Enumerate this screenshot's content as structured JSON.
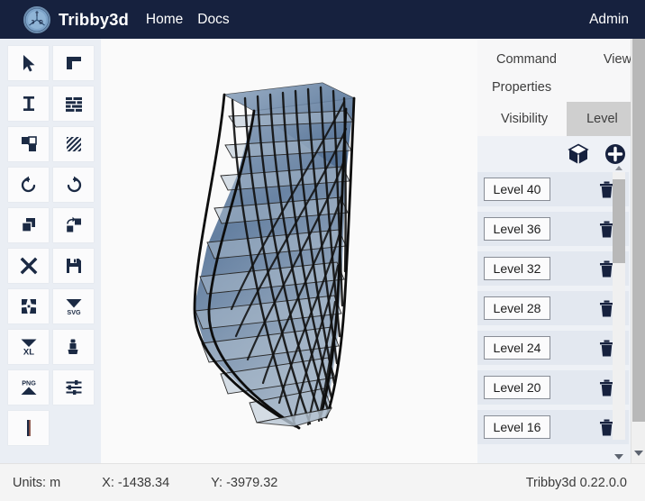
{
  "navbar": {
    "logo_letters": [
      "T",
      "3",
      "D"
    ],
    "brand": "Tribby3d",
    "links": [
      {
        "label": "Home"
      },
      {
        "label": "Docs"
      }
    ],
    "account": "Admin"
  },
  "toolbar": {
    "tools": [
      {
        "name": "select-cursor",
        "label": "Select"
      },
      {
        "name": "slab-corner",
        "label": "Slab"
      },
      {
        "name": "column",
        "label": "Column"
      },
      {
        "name": "wall-brick",
        "label": "Wall"
      },
      {
        "name": "opening",
        "label": "Opening"
      },
      {
        "name": "hatch-area",
        "label": "Area load"
      },
      {
        "name": "undo-arrow",
        "label": "Undo"
      },
      {
        "name": "redo-arrow",
        "label": "Redo"
      },
      {
        "name": "copy-duplicate",
        "label": "Copy"
      },
      {
        "name": "move-to",
        "label": "Move"
      },
      {
        "name": "delete-cross",
        "label": "Delete"
      },
      {
        "name": "save-floppy",
        "label": "Save"
      },
      {
        "name": "import-dxf",
        "label": "Import DXF"
      },
      {
        "name": "export-svg",
        "label": "Export SVG"
      },
      {
        "name": "export-xl",
        "label": "Export XLSX"
      },
      {
        "name": "export-rhino",
        "label": "Export Rhino"
      },
      {
        "name": "export-png",
        "label": "Export PNG"
      },
      {
        "name": "settings-sliders",
        "label": "Settings"
      },
      {
        "name": "measure-line",
        "label": "Measure"
      }
    ]
  },
  "viewport": {
    "model_name": "twisted-tower-mesh",
    "mesh_color": "#4f6f96",
    "line_color": "#1b1b1b"
  },
  "right_panel": {
    "tabs": [
      {
        "label": "Command"
      },
      {
        "label": "View"
      }
    ],
    "section": "Properties",
    "subtabs": [
      {
        "label": "Visibility",
        "active": false
      },
      {
        "label": "Level",
        "active": true
      }
    ],
    "actions": [
      {
        "name": "cube-icon",
        "label": "3D view"
      },
      {
        "name": "plus-circle-icon",
        "label": "Add level"
      }
    ],
    "levels": [
      {
        "label": "Level 40"
      },
      {
        "label": "Level 36"
      },
      {
        "label": "Level 32"
      },
      {
        "label": "Level 28"
      },
      {
        "label": "Level 24"
      },
      {
        "label": "Level 20"
      },
      {
        "label": "Level 16"
      }
    ]
  },
  "statusbar": {
    "units": "Units: m",
    "x": "X: -1438.34",
    "y": "Y: -3979.32",
    "version": "Tribby3d 0.22.0.0"
  }
}
